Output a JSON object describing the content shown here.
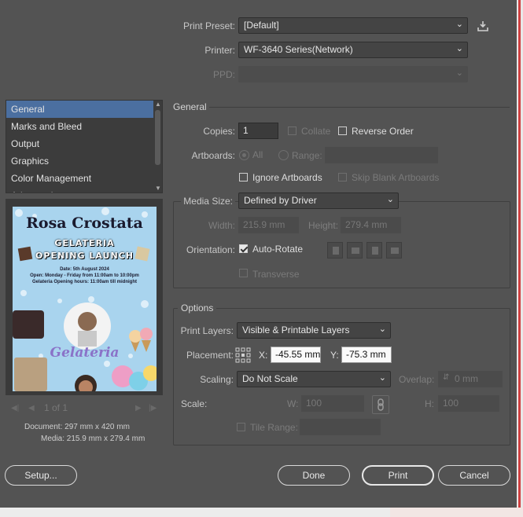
{
  "top": {
    "print_preset_label": "Print Preset:",
    "print_preset_value": "[Default]",
    "printer_label": "Printer:",
    "printer_value": "WF-3640 Series(Network)",
    "ppd_label": "PPD:",
    "ppd_value": ""
  },
  "sidebar": {
    "items": [
      "General",
      "Marks and Bleed",
      "Output",
      "Graphics",
      "Color Management",
      "Advanced"
    ],
    "selected_index": 0
  },
  "preview": {
    "poster_title": "Rosa Crostata",
    "poster_subtitle_1": "GELATERIA",
    "poster_subtitle_2": "OPENING LAUNCH",
    "poster_date": "Date: 5th August 2024",
    "poster_open": "Open: Monday - Friday from 11:00am to 10:00pm",
    "poster_hours": "Gelateria Opening hours: 11:00am till midnight",
    "poster_shop": "Gelateria",
    "page_indicator": "1 of 1",
    "document_size": "Document: 297 mm x 420 mm",
    "media_size": "Media: 215.9 mm x 279.4 mm"
  },
  "general": {
    "section_title": "General",
    "copies_label": "Copies:",
    "copies_value": "1",
    "collate_label": "Collate",
    "reverse_order_label": "Reverse Order",
    "artboards_label": "Artboards:",
    "all_label": "All",
    "range_label": "Range:",
    "range_value": "",
    "ignore_artboards_label": "Ignore Artboards",
    "skip_blank_label": "Skip Blank Artboards",
    "media_size_label": "Media Size:",
    "media_size_value": "Defined by Driver",
    "width_label": "Width:",
    "width_value": "215.9 mm",
    "height_label": "Height:",
    "height_value": "279.4 mm",
    "orientation_label": "Orientation:",
    "auto_rotate_label": "Auto-Rotate",
    "transverse_label": "Transverse"
  },
  "options": {
    "section_title": "Options",
    "print_layers_label": "Print Layers:",
    "print_layers_value": "Visible & Printable Layers",
    "placement_label": "Placement:",
    "x_label": "X:",
    "x_value": "-45.55 mm",
    "y_label": "Y:",
    "y_value": "-75.3 mm",
    "scaling_label": "Scaling:",
    "scaling_value": "Do Not Scale",
    "overlap_label": "Overlap:",
    "overlap_value": "0 mm",
    "scale_label": "Scale:",
    "w_label": "W:",
    "w_value": "100",
    "h_label": "H:",
    "h_value": "100",
    "tile_range_label": "Tile Range:",
    "tile_range_value": ""
  },
  "buttons": {
    "setup": "Setup...",
    "done": "Done",
    "print": "Print",
    "cancel": "Cancel"
  },
  "colors": {
    "dialog_bg": "#535353",
    "sidebar_selected": "#4b6fa0",
    "preview_sky": "#a9d4ee",
    "poster_title": "#1a1a2e",
    "poster_shop": "#8a72c8"
  }
}
